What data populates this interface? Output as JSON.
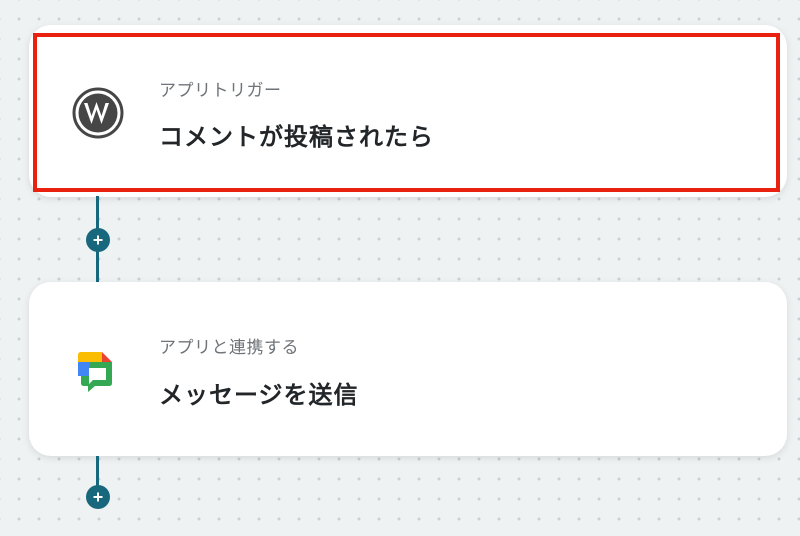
{
  "flow": {
    "trigger": {
      "kind_label": "アプリトリガー",
      "title": "コメントが投稿されたら",
      "icon": "wordpress-icon"
    },
    "action": {
      "kind_label": "アプリと連携する",
      "title": "メッセージを送信",
      "icon": "google-chat-icon"
    },
    "add_step_icon": "plus-icon"
  },
  "colors": {
    "highlight_border": "#e8220f",
    "connector": "#17677d",
    "card_background": "#ffffff",
    "canvas_background": "#eef2f3"
  }
}
